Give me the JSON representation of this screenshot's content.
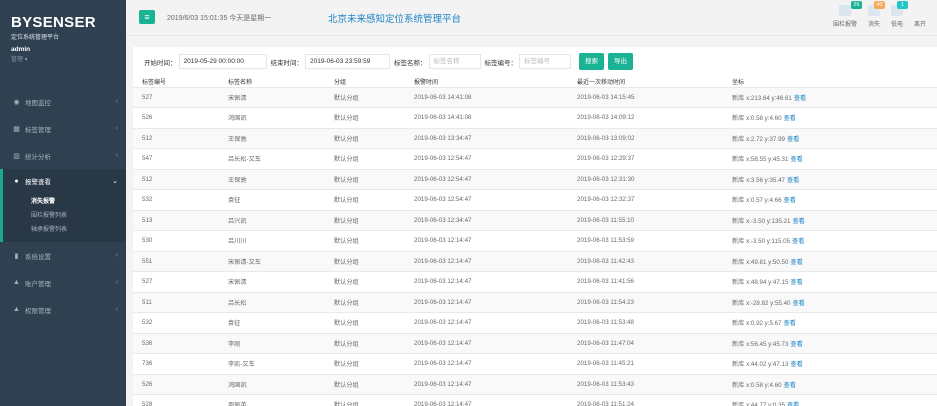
{
  "brand": {
    "title": "BYSENSER",
    "subtitle": "定位系统管理平台",
    "user": "admin",
    "role": "管理 ▾"
  },
  "sidebar": {
    "items": [
      {
        "icon": "◉",
        "label": "地图监控"
      },
      {
        "icon": "▦",
        "label": "标签管理"
      },
      {
        "icon": "▥",
        "label": "统计分析"
      },
      {
        "icon": "●",
        "label": "报警查看"
      },
      {
        "icon": "▮",
        "label": "系统设置"
      },
      {
        "icon": "▲",
        "label": "账户管理"
      },
      {
        "icon": "▲",
        "label": "权限管理"
      }
    ],
    "subitems": [
      "消失报警",
      "围栏报警列表",
      "轴承报警列表"
    ]
  },
  "topbar": {
    "menu_icon": "≡",
    "datetime": "2019/6/03 15:01:35 今天是星期一",
    "platform": "北京未来感知定位系统管理平台",
    "right_items": [
      {
        "label": "围栏报警",
        "badge": "26",
        "badge_color": "#1ab394"
      },
      {
        "label": "消失",
        "badge": "40",
        "badge_color": "#f8ac59"
      },
      {
        "label": "低电",
        "badge": "1",
        "badge_color": "#23c6c8"
      },
      {
        "label": "离开",
        "badge": "",
        "badge_color": ""
      }
    ]
  },
  "filters": {
    "start_label": "开始时间：",
    "start_value": "2019-05-29 00:00:00",
    "end_label": "结束时间：",
    "end_value": "2019-06-03 23:59:59",
    "name_label": "标签名称：",
    "name_placeholder": "标签名称",
    "id_label": "标签编号：",
    "id_placeholder": "标签编号",
    "search_button": "搜索",
    "export_button": "导出"
  },
  "table": {
    "columns": [
      "标签编号",
      "标签名称",
      "分组",
      "报警时间",
      "最近一次移动时间",
      "坐标"
    ],
    "view_label": "查看",
    "rows": [
      {
        "id": "527",
        "name": "宋佩清",
        "group": "默认分组",
        "alarm_time": "2019-06-03 14:41:08",
        "last_move": "2019-06-03 14:15:45",
        "coord": "新库 x:213.64 y:46.61"
      },
      {
        "id": "526",
        "name": "鸿国凯",
        "group": "默认分组",
        "alarm_time": "2019-06-03 14:41:08",
        "last_move": "2019-06-03 14:09:12",
        "coord": "新库 x:0.58 y:4.60"
      },
      {
        "id": "512",
        "name": "王保驰",
        "group": "默认分组",
        "alarm_time": "2019-06-03 13:34:47",
        "last_move": "2019-06-03 13:09:02",
        "coord": "新库 x:2.72 y:37.99"
      },
      {
        "id": "547",
        "name": "吕长松-又车",
        "group": "默认分组",
        "alarm_time": "2019-06-03 12:54:47",
        "last_move": "2019-06-03 12:29:37",
        "coord": "新库 x:58.55 y:45.31"
      },
      {
        "id": "512",
        "name": "王保驰",
        "group": "默认分组",
        "alarm_time": "2019-06-03 12:54:47",
        "last_move": "2019-06-03 12:31:30",
        "coord": "新库 x:3.56 y:35.47"
      },
      {
        "id": "532",
        "name": "袁征",
        "group": "默认分组",
        "alarm_time": "2019-06-03 12:54:47",
        "last_move": "2019-06-03 12:32:37",
        "coord": "新库 x:0.57 y:4.66"
      },
      {
        "id": "513",
        "name": "吕兴凯",
        "group": "默认分组",
        "alarm_time": "2019-06-03 12:34:47",
        "last_move": "2019-06-03 11:55:10",
        "coord": "新库 x:-3.50 y:135.21"
      },
      {
        "id": "530",
        "name": "吕川川",
        "group": "默认分组",
        "alarm_time": "2019-06-03 12:14:47",
        "last_move": "2019-06-03 11:53:59",
        "coord": "新库 x:-3.50 y:115.05"
      },
      {
        "id": "551",
        "name": "宋佩清-又车",
        "group": "默认分组",
        "alarm_time": "2019-06-03 12:14:47",
        "last_move": "2019-06-03 11:42:43",
        "coord": "新库 x:49.81 y:50.50"
      },
      {
        "id": "527",
        "name": "宋佩清",
        "group": "默认分组",
        "alarm_time": "2019-06-03 12:14:47",
        "last_move": "2019-06-03 11:41:56",
        "coord": "新库 x:48.94 y:47.15"
      },
      {
        "id": "511",
        "name": "吕长松",
        "group": "默认分组",
        "alarm_time": "2019-06-03 12:14:47",
        "last_move": "2019-06-03 11:54:23",
        "coord": "新库 x:-28.82 y:55.40"
      },
      {
        "id": "532",
        "name": "袁征",
        "group": "默认分组",
        "alarm_time": "2019-06-03 12:14:47",
        "last_move": "2019-06-03 11:53:48",
        "coord": "新库 x:0.92 y:5.67"
      },
      {
        "id": "536",
        "name": "李刚",
        "group": "默认分组",
        "alarm_time": "2019-06-03 12:14:47",
        "last_move": "2019-06-03 11:47:04",
        "coord": "新库 x:56.45 y:45.73"
      },
      {
        "id": "736",
        "name": "李凯-又车",
        "group": "默认分组",
        "alarm_time": "2019-06-03 12:14:47",
        "last_move": "2019-06-03 11:45:21",
        "coord": "新库 x:44.02 y:47.13"
      },
      {
        "id": "526",
        "name": "鸿国凯",
        "group": "默认分组",
        "alarm_time": "2019-06-03 12:14:47",
        "last_move": "2019-06-03 11:53:43",
        "coord": "新库 x:0.58 y:4.60"
      },
      {
        "id": "528",
        "name": "周佩英",
        "group": "默认分组",
        "alarm_time": "2019-06-03 12:14:47",
        "last_move": "2019-06-03 11:51:24",
        "coord": "新库 x:44.77 y:0.35"
      }
    ]
  }
}
